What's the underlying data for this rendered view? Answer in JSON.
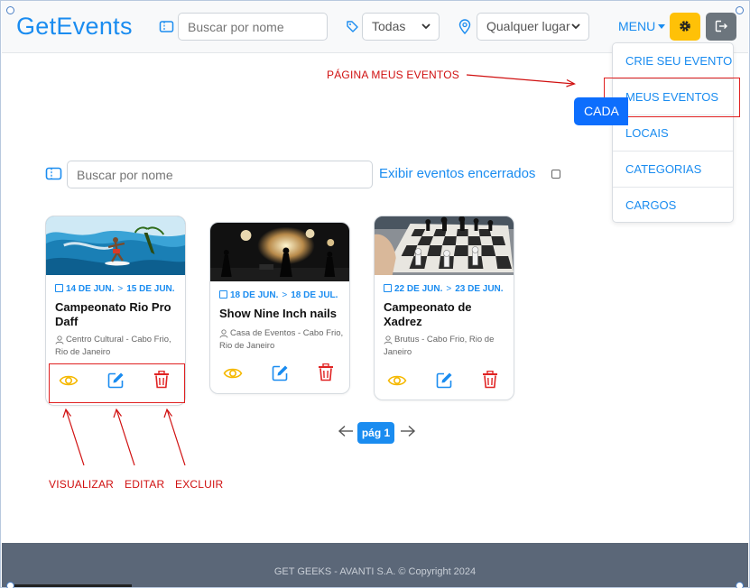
{
  "header": {
    "brand": "GetEvents",
    "search_placeholder": "Buscar por nome",
    "category_select": "Todas",
    "location_select": "Qualquer lugar",
    "menu_label": "MENU"
  },
  "dropdown": {
    "items": [
      "CRIE SEU EVENTO",
      "MEUS EVENTOS",
      "LOCAIS",
      "CATEGORIAS",
      "CARGOS"
    ]
  },
  "create_button_partial": "CADA",
  "annotations": {
    "page_label": "PÁGINA MEUS EVENTOS",
    "view": "VISUALIZAR",
    "edit": "EDITAR",
    "delete": "EXCLUIR"
  },
  "filters": {
    "search_placeholder": "Buscar por nome",
    "show_closed_label": "Exibir eventos encerrados"
  },
  "events": [
    {
      "start": "14 DE JUN.",
      "end": "15 DE JUN.",
      "title": "Campeonato Rio Pro Daff",
      "place": "Centro Cultural - Cabo Frio, Rio de Janeiro",
      "photo": "surfer-photo"
    },
    {
      "start": "18 DE JUN.",
      "end": "18 DE JUL.",
      "title": "Show Nine Inch nails",
      "place": "Casa de Eventos - Cabo Frio, Rio de Janeiro",
      "photo": "concert-photo"
    },
    {
      "start": "22 DE JUN.",
      "end": "23 DE JUN.",
      "title": "Campeonato de Xadrez",
      "place": "Brutus - Cabo Frio, Rio de Janeiro",
      "photo": "chess-photo"
    }
  ],
  "pagination": {
    "current": "pág 1"
  },
  "footer": {
    "text": "GET GEEKS - AVANTI S.A. © Copyright 2024"
  },
  "colors": {
    "brand_blue": "#1a8cf0",
    "view_yellow": "#f5b800",
    "delete_red": "#e02424",
    "annotation_red": "#d01010",
    "footer_bg": "#5b6778"
  }
}
